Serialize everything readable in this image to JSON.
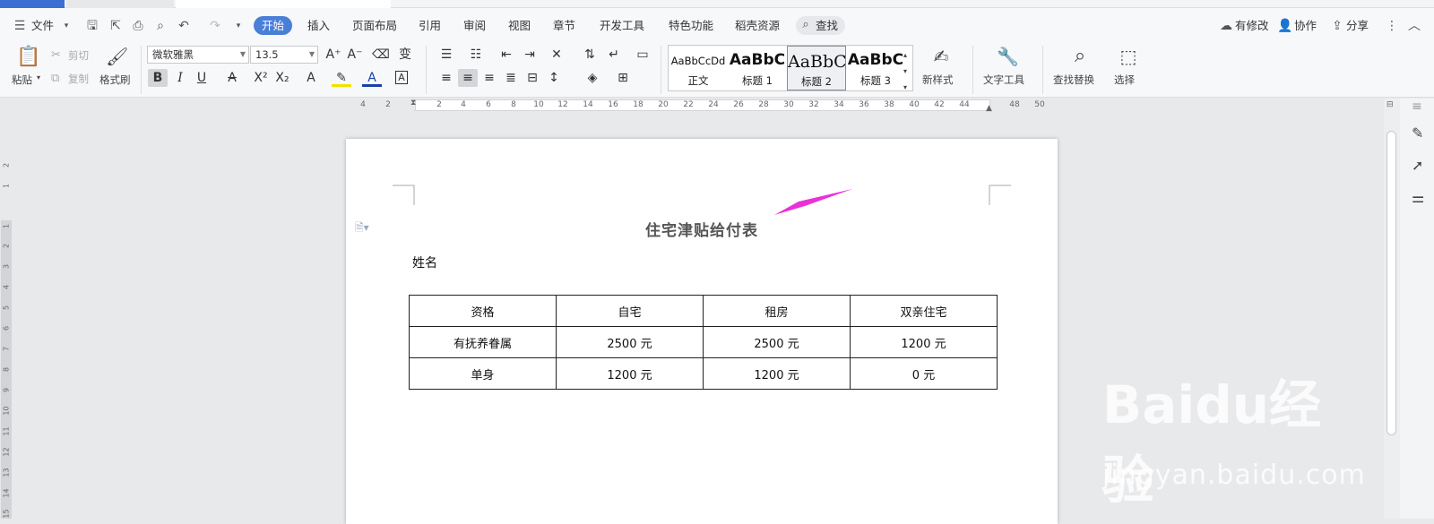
{
  "menu": {
    "file": "文件",
    "tabs": [
      "开始",
      "插入",
      "页面布局",
      "引用",
      "审阅",
      "视图",
      "章节",
      "开发工具",
      "特色功能",
      "稻壳资源"
    ],
    "search": "查找",
    "right": [
      "有修改",
      "协作",
      "分享"
    ]
  },
  "ribbon": {
    "paste": "粘贴",
    "cut": "剪切",
    "copy": "复制",
    "format_painter": "格式刷",
    "font_name": "微软雅黑",
    "font_size": "13.5",
    "styles": [
      {
        "preview": "AaBbCcDd",
        "name": "正文"
      },
      {
        "preview": "AaBbC",
        "name": "标题 1"
      },
      {
        "preview": "AaBbC",
        "name": "标题 2"
      },
      {
        "preview": "AaBbC",
        "name": "标题 3"
      }
    ],
    "new_style": "新样式",
    "text_tools": "文字工具",
    "find_replace": "查找替换",
    "select": "选择"
  },
  "ruler": {
    "h": [
      "4",
      "2",
      "2",
      "4",
      "6",
      "8",
      "10",
      "12",
      "14",
      "16",
      "18",
      "20",
      "22",
      "24",
      "26",
      "28",
      "30",
      "32",
      "34",
      "36",
      "38",
      "40",
      "42",
      "44",
      "48",
      "50"
    ],
    "v": [
      "2",
      "1",
      "1",
      "2",
      "3",
      "4",
      "5",
      "6",
      "7",
      "8",
      "9",
      "10",
      "11",
      "12",
      "13",
      "14",
      "15"
    ]
  },
  "document": {
    "title": "住宅津贴给付表",
    "name_label": "姓名",
    "table": [
      [
        "资格",
        "自宅",
        "租房",
        "双亲住宅"
      ],
      [
        "有抚养眷属",
        "2500 元",
        "2500 元",
        "1200 元"
      ],
      [
        "单身",
        "1200 元",
        "1200 元",
        "0 元"
      ]
    ]
  },
  "watermark": {
    "text": "Baidu经验",
    "url": "jingyan.baidu.com"
  },
  "colors": {
    "accent": "#4a7fd8",
    "arrow": "#e832d8"
  }
}
